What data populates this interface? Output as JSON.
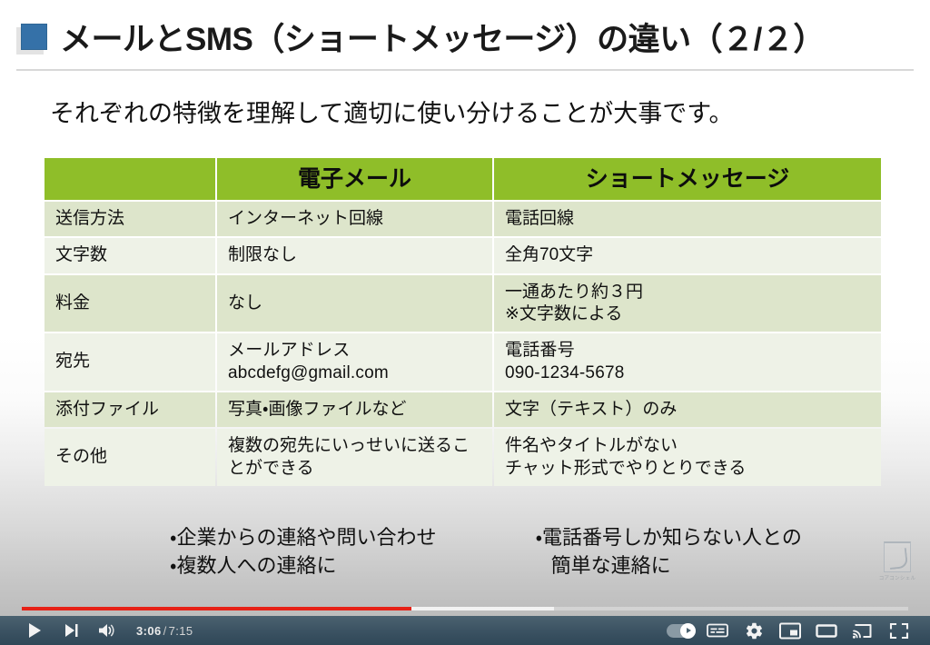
{
  "slide": {
    "title": "メールとSMS（ショートメッセージ）の違い（２/２）",
    "subtitle": "それぞれの特徴を理解して適切に使い分けることが大事です。",
    "table": {
      "headers": [
        "",
        "電子メール",
        "ショートメッセージ"
      ],
      "rows": [
        {
          "label": "送信方法",
          "email": "インターネット回線",
          "sms": "電話回線"
        },
        {
          "label": "文字数",
          "email": "制限なし",
          "sms": "全角70文字"
        },
        {
          "label": "料金",
          "email": "なし",
          "sms_line1": "一通あたり約３円",
          "sms_line2": "※文字数による"
        },
        {
          "label": "宛先",
          "email_line1": "メールアドレス",
          "email_line2": "abcdefg@gmail.com",
          "sms_line1": "電話番号",
          "sms_line2": "090-1234-5678"
        },
        {
          "label": "添付ファイル",
          "email": "写真・画像ファイルなど",
          "sms": "文字（テキスト）のみ"
        },
        {
          "label": "その他",
          "email_line1": "複数の宛先にいっせいに送るこ",
          "email_line2": "とができる",
          "sms_line1": "件名やタイトルがない",
          "sms_line2": "チャット形式でやりとりできる"
        }
      ]
    },
    "notes": {
      "left": [
        "・企業からの連絡や問い合わせ",
        "・複数人への連絡に"
      ],
      "right": [
        "・電話番号しか知らない人との",
        "簡単な連絡に"
      ]
    },
    "watermark": "コアコンシェル"
  },
  "player": {
    "current_time": "3:06",
    "separator": "/",
    "total_time": "7:15",
    "played_percent": 44,
    "loaded_percent": 60,
    "accent_color": "#e62117",
    "controls": {
      "play": "play-arrow",
      "next": "next-video",
      "volume": "volume-on",
      "autoplay": "autoplay-on",
      "subtitles": "subtitles",
      "settings": "settings-gear",
      "miniplayer": "miniplayer",
      "theater": "theater-mode",
      "cast": "cast",
      "fullscreen": "fullscreen"
    }
  }
}
